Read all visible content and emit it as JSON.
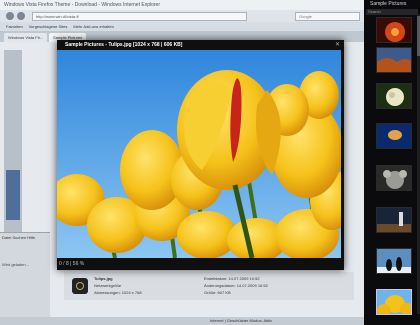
{
  "browser": {
    "title": "Windows Vista Firefox Theme - Download - Windows Internet Explorer",
    "url": "http://www.win.dl/vista-ff",
    "search_placeholder": "Google",
    "bookmarks": [
      "Favoriten",
      "Vorgeschlagene Sites",
      "Mehr Add-ons erhalten"
    ],
    "tabs": [
      "Windows Vista Fir...",
      "Sample Pictures"
    ],
    "panel_menu": "Datei Suchen Hilfe",
    "panel_text": "Wird geladen...",
    "status": "Internet | Geschützter Modus: Aktiv",
    "download": {
      "name": "Tulips.jpg",
      "size_label": "Netzwerkgröße",
      "date_label": "Erstelldatum: 14.07.2009 10:52",
      "size": "Größe: 607 KB",
      "info": "Abmessungen: 1024 x 768",
      "modified": "Änderungsdatum: 14.07.2009 10:52"
    }
  },
  "viewer": {
    "title": "Sample Pictures - Tulips.jpg [1024 x 768 | 606 KB]",
    "close": "✕",
    "footer": "0 / 8  |  56 %"
  },
  "sidebar": {
    "title": "Sample Pictures",
    "search_placeholder": "Search",
    "thumbnails": [
      {
        "name": "Chrysanthemum",
        "selected": false
      },
      {
        "name": "Desert",
        "selected": false
      },
      {
        "name": "Hydrangeas",
        "selected": false
      },
      {
        "name": "Jellyfish",
        "selected": false
      },
      {
        "name": "Koala",
        "selected": false
      },
      {
        "name": "Lighthouse",
        "selected": false
      },
      {
        "name": "Penguins",
        "selected": false
      },
      {
        "name": "Tulips",
        "selected": true
      }
    ]
  },
  "colors": {
    "tulip_yellow": "#f5c21a",
    "tulip_red": "#c8241a",
    "sky": "#5aa7e6",
    "stem_green": "#3f6e1c"
  }
}
